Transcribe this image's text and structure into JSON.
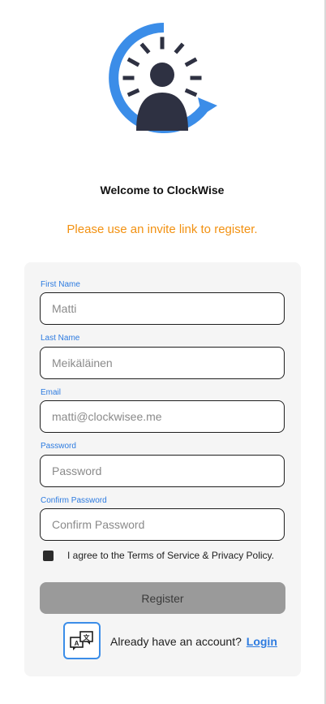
{
  "app": {
    "title": "Welcome to ClockWise",
    "notice": "Please use an invite link to register."
  },
  "form": {
    "first_name": {
      "label": "First Name",
      "placeholder": "Matti"
    },
    "last_name": {
      "label": "Last Name",
      "placeholder": "Meikäläinen"
    },
    "email": {
      "label": "Email",
      "placeholder": "matti@clockwisee.me"
    },
    "password": {
      "label": "Password",
      "placeholder": "Password"
    },
    "confirm_password": {
      "label": "Confirm Password",
      "placeholder": "Confirm Password"
    },
    "agree_text": "I agree to the Terms of Service & Privacy Policy.",
    "register_label": "Register"
  },
  "footer": {
    "account_text": "Already have an account?",
    "login_label": "Login",
    "language_icon": "translate-icon"
  },
  "colors": {
    "accent": "#2d7be0",
    "notice": "#f29111",
    "logo_ring": "#3b8de8",
    "logo_dark": "#2e3142",
    "button": "#9a9a9a"
  }
}
